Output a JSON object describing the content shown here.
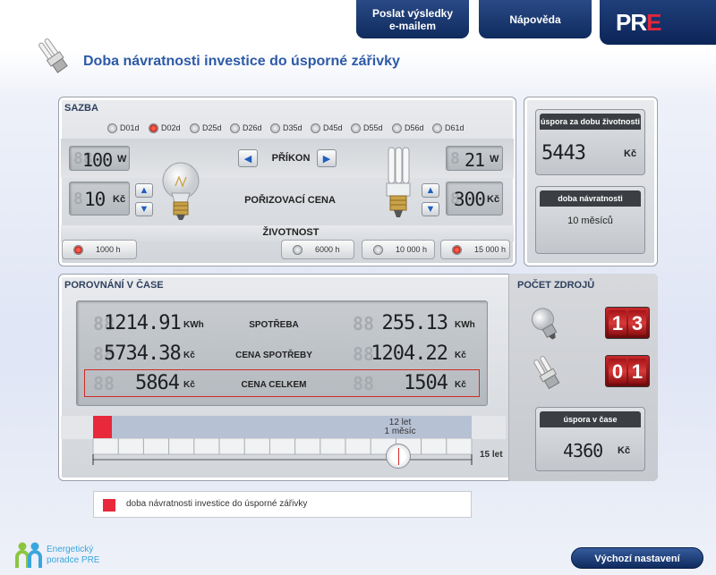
{
  "header": {
    "email_button": "Poslat výsledky\ne-mailem",
    "help_button": "Nápověda",
    "logo_pr": "PR",
    "logo_e": "E"
  },
  "title": "Doba návratnosti investice do úsporné zářivky",
  "sazba": {
    "label": "SAZBA",
    "tabs": [
      "D01d",
      "D02d",
      "D25d",
      "D26d",
      "D35d",
      "D45d",
      "D55d",
      "D56d",
      "D61d"
    ],
    "selected": "D02d"
  },
  "prikon": {
    "label": "PŘÍKON",
    "left_value": "100",
    "left_unit": "W",
    "right_value": "21",
    "right_unit": "W"
  },
  "cena": {
    "label": "POŘIZOVACÍ CENA",
    "left_value": "10",
    "left_unit": "Kč",
    "right_value": "300",
    "right_unit": "Kč"
  },
  "zivotnost": {
    "label": "ŽIVOTNOST",
    "left_option": "1000 h",
    "options": [
      "6000 h",
      "10 000 h",
      "15 000 h"
    ],
    "selected": "15 000 h"
  },
  "summary": {
    "uspora_label": "úspora za dobu životnosti",
    "uspora_value": "5443",
    "uspora_unit": "Kč",
    "navratnost_label": "doba návratnosti",
    "navratnost_value": "10 měsíců"
  },
  "porovnani": {
    "label": "POROVNÁNÍ V ČASE",
    "rows": [
      {
        "left": "1214.91",
        "left_unit": "KWh",
        "label": "SPOTŘEBA",
        "right": "255.13",
        "right_unit": "KWh"
      },
      {
        "left": "5734.38",
        "left_unit": "Kč",
        "label": "CENA SPOTŘEBY",
        "right": "1204.22",
        "right_unit": "Kč"
      },
      {
        "left": "5864",
        "left_unit": "Kč",
        "label": "CENA CELKEM",
        "right": "1504",
        "right_unit": "Kč"
      }
    ],
    "timeline_years": "12 let",
    "timeline_months": "1 měsíc",
    "timeline_end": "15 let",
    "timeline_fraction": 0.806
  },
  "pocet": {
    "label": "POČET ZDROJŮ",
    "bulb_digits": [
      "1",
      "3"
    ],
    "cfl_digits": [
      "0",
      "1"
    ],
    "uspora_cas_label": "úspora v čase",
    "uspora_cas_value": "4360",
    "uspora_cas_unit": "Kč"
  },
  "legend": {
    "text": "doba návratnosti investice do úsporné zářivky",
    "color": "#e8283b"
  },
  "footer": {
    "brand_line1": "Energetický",
    "brand_line2": "poradce PRE",
    "reset_button": "Výchozí nastavení"
  }
}
